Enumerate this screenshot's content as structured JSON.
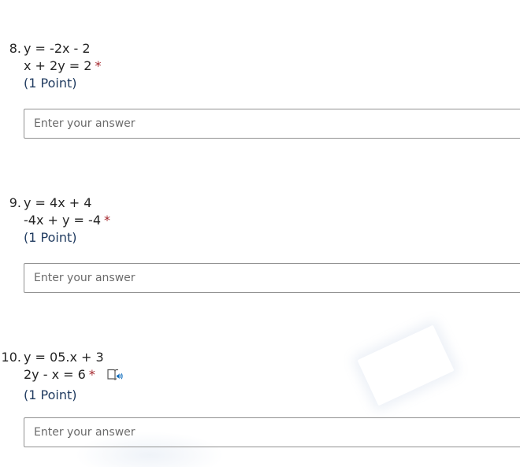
{
  "questions": [
    {
      "number": "8.",
      "line1": "y = -2x - 2",
      "line2": "x + 2y = 2",
      "required_mark": "*",
      "points": "(1 Point)",
      "answer_placeholder": "Enter your answer",
      "answer_value": ""
    },
    {
      "number": "9.",
      "line1": "y = 4x + 4",
      "line2": "-4x + y = -4",
      "required_mark": "*",
      "points": "(1 Point)",
      "answer_placeholder": "Enter your answer",
      "answer_value": ""
    },
    {
      "number": "10.",
      "line1": "y = 05.x + 3",
      "line2": "2y - x = 6",
      "required_mark": "*",
      "points": "(1 Point)",
      "answer_placeholder": "Enter your answer",
      "answer_value": "",
      "icon": "immersive-reader-icon"
    }
  ],
  "colors": {
    "required": "#a4262c",
    "points": "#1f3a5f",
    "input_border": "#919191",
    "reader_icon": "#0f6cbd"
  }
}
